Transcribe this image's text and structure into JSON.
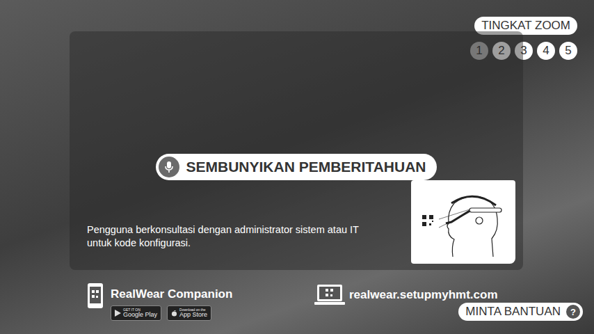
{
  "zoom": {
    "label": "TINGKAT ZOOM",
    "levels": [
      {
        "label": "1",
        "selected": true
      },
      {
        "label": "2",
        "selected": false
      },
      {
        "label": "3",
        "selected": false
      },
      {
        "label": "4",
        "selected": false
      },
      {
        "label": "5",
        "selected": false
      }
    ]
  },
  "notification": {
    "hide_button": "SEMBUNYIKAN PEMBERITAHUAN",
    "message": "Pengguna berkonsultasi dengan administrator sistem atau IT untuk kode konfigurasi."
  },
  "companion": {
    "title": "RealWear Companion",
    "badges": [
      {
        "small": "GET IT ON",
        "store": "Google Play"
      },
      {
        "small": "Download on the",
        "store": "App Store"
      }
    ]
  },
  "setup_url": "realwear.setupmyhmt.com",
  "help_button": {
    "label": "MINTA BANTUAN",
    "icon": "?"
  }
}
